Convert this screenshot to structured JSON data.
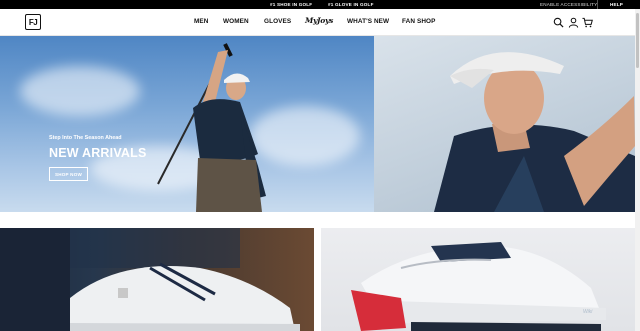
{
  "topbar": {
    "promo_1": "#1 SHOE IN GOLF",
    "promo_2": "#1 GLOVE IN GOLF",
    "accessibility": "ENABLE ACCESSIBILITY",
    "help": "HELP"
  },
  "nav": {
    "logo": "FJ",
    "items": [
      "MEN",
      "WOMEN",
      "GLOVES",
      "MyJoys",
      "WHAT'S NEW",
      "FAN SHOP"
    ],
    "icons": [
      "search-icon",
      "account-icon",
      "cart-icon"
    ]
  },
  "hero": {
    "eyebrow": "Step Into The Season Ahead",
    "headline": "NEW ARRIVALS",
    "cta": "SHOP NOW"
  },
  "colors": {
    "topbar_bg": "#000000",
    "text": "#111111",
    "hero_text": "#ffffff"
  }
}
